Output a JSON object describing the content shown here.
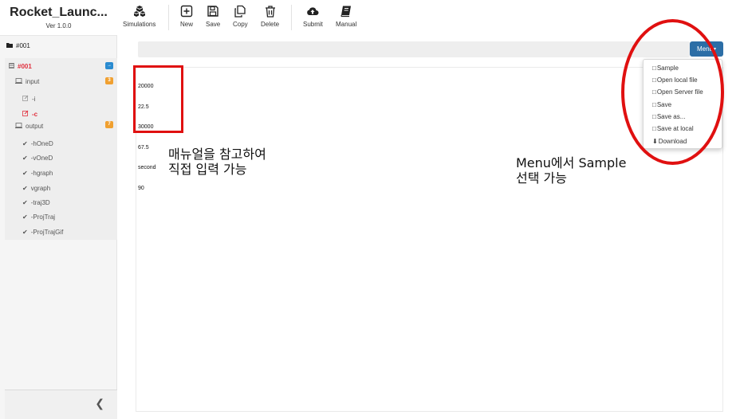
{
  "app": {
    "title": "Rocket_Launc...",
    "version": "Ver 1.0.0"
  },
  "folder": {
    "label": "#001"
  },
  "tree": {
    "root": {
      "label": "#001",
      "badge": "→"
    },
    "input": {
      "label": "input",
      "badge": "3"
    },
    "input_items": [
      "-i",
      "-c"
    ],
    "output": {
      "label": "output",
      "badge": "7"
    },
    "output_items": [
      "-hOneD",
      "-vOneD",
      "-hgraph",
      "vgraph",
      "-traj3D",
      "-ProjTraj",
      "-ProjTrajGif"
    ]
  },
  "toolbar": {
    "simulations": "Simulations",
    "new": "New",
    "save": "Save",
    "copy": "Copy",
    "delete": "Delete",
    "submit": "Submit",
    "manual": "Manual"
  },
  "menu": {
    "label": "Menu",
    "items": [
      "Sample",
      "Open local file",
      "Open Server file",
      "Save",
      "Save as...",
      "Save at local",
      "Download"
    ]
  },
  "editor": {
    "lines": [
      "20000",
      "22.5",
      "30000",
      "67.5",
      "second",
      "90"
    ]
  },
  "annotations": {
    "left_line1": "매뉴얼을 참고하여",
    "left_line2": "직접 입력 가능",
    "right_line1": "Menu에서 Sample",
    "right_line2": "선택 가능"
  },
  "colors": {
    "accent": "#2c6ea6",
    "highlight": "#e01010",
    "active": "#e0303e"
  }
}
